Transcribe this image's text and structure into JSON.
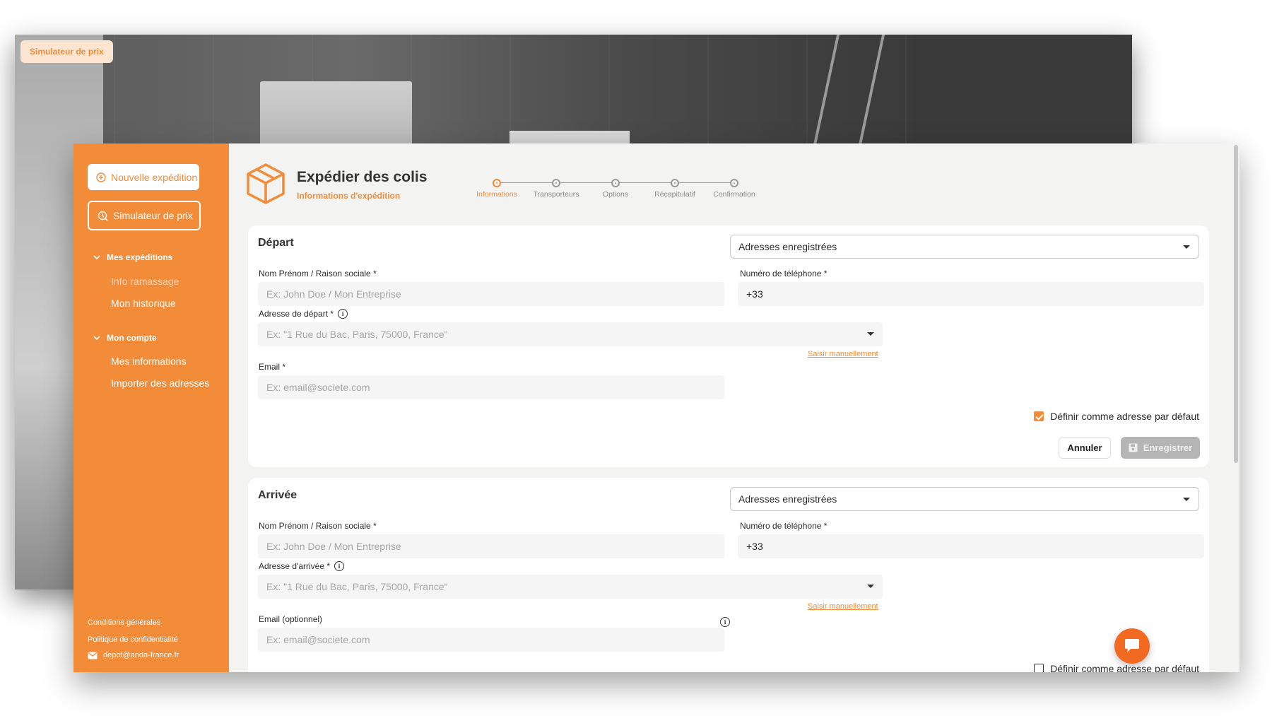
{
  "background": {
    "badge_label": "Simulateur de prix"
  },
  "sidebar": {
    "new_shipment_label": "Nouvelle expédition",
    "price_simulator_label": "Simulateur de prix",
    "sections": [
      {
        "label": "Mes expéditions",
        "items": [
          "Info ramassage",
          "Mon historique"
        ]
      },
      {
        "label": "Mon compte",
        "items": [
          "Mes informations",
          "Importer des adresses"
        ]
      }
    ],
    "footer": {
      "terms": "Conditions générales",
      "privacy": "Politique de confidentialité",
      "email": "depot@anda-france.fr"
    }
  },
  "header": {
    "title": "Expédier des colis",
    "subtitle": "Informations d'expédition",
    "icon": "package-icon"
  },
  "stepper": {
    "steps": [
      "Informations",
      "Transporteurs",
      "Options",
      "Récapitulatif",
      "Confirmation"
    ],
    "active_index": 0
  },
  "departure": {
    "title": "Départ",
    "saved_addresses": "Adresses enregistrées",
    "name_label": "Nom Prénom / Raison sociale *",
    "name_placeholder": "Ex: John Doe / Mon Entreprise",
    "phone_label": "Numéro de téléphone *",
    "phone_value": "+33",
    "address_label": "Adresse de départ *",
    "address_placeholder": "Ex: \"1 Rue du Bac, Paris, 75000, France\"",
    "manual_link": "Saisir manuellement",
    "email_label": "Email *",
    "email_placeholder": "Ex: email@societe.com",
    "default_label": "Définir comme adresse par défaut",
    "default_checked": true,
    "cancel_label": "Annuler",
    "save_label": "Enregistrer"
  },
  "arrival": {
    "title": "Arrivée",
    "saved_addresses": "Adresses enregistrées",
    "name_label": "Nom Prénom / Raison sociale *",
    "name_placeholder": "Ex: John Doe / Mon Entreprise",
    "phone_label": "Numéro de téléphone *",
    "phone_value": "+33",
    "address_label": "Adresse d'arrivée *",
    "address_placeholder": "Ex: \"1 Rue du Bac, Paris, 75000, France\"",
    "manual_link": "Saisir manuellement",
    "email_label": "Email (optionnel)",
    "email_placeholder": "Ex: email@societe.com",
    "default_label": "Définir comme adresse par défaut",
    "default_checked": false
  },
  "colors": {
    "accent": "#f28c38",
    "chat": "#f26a22",
    "disabled_button": "#b5b5b5"
  }
}
